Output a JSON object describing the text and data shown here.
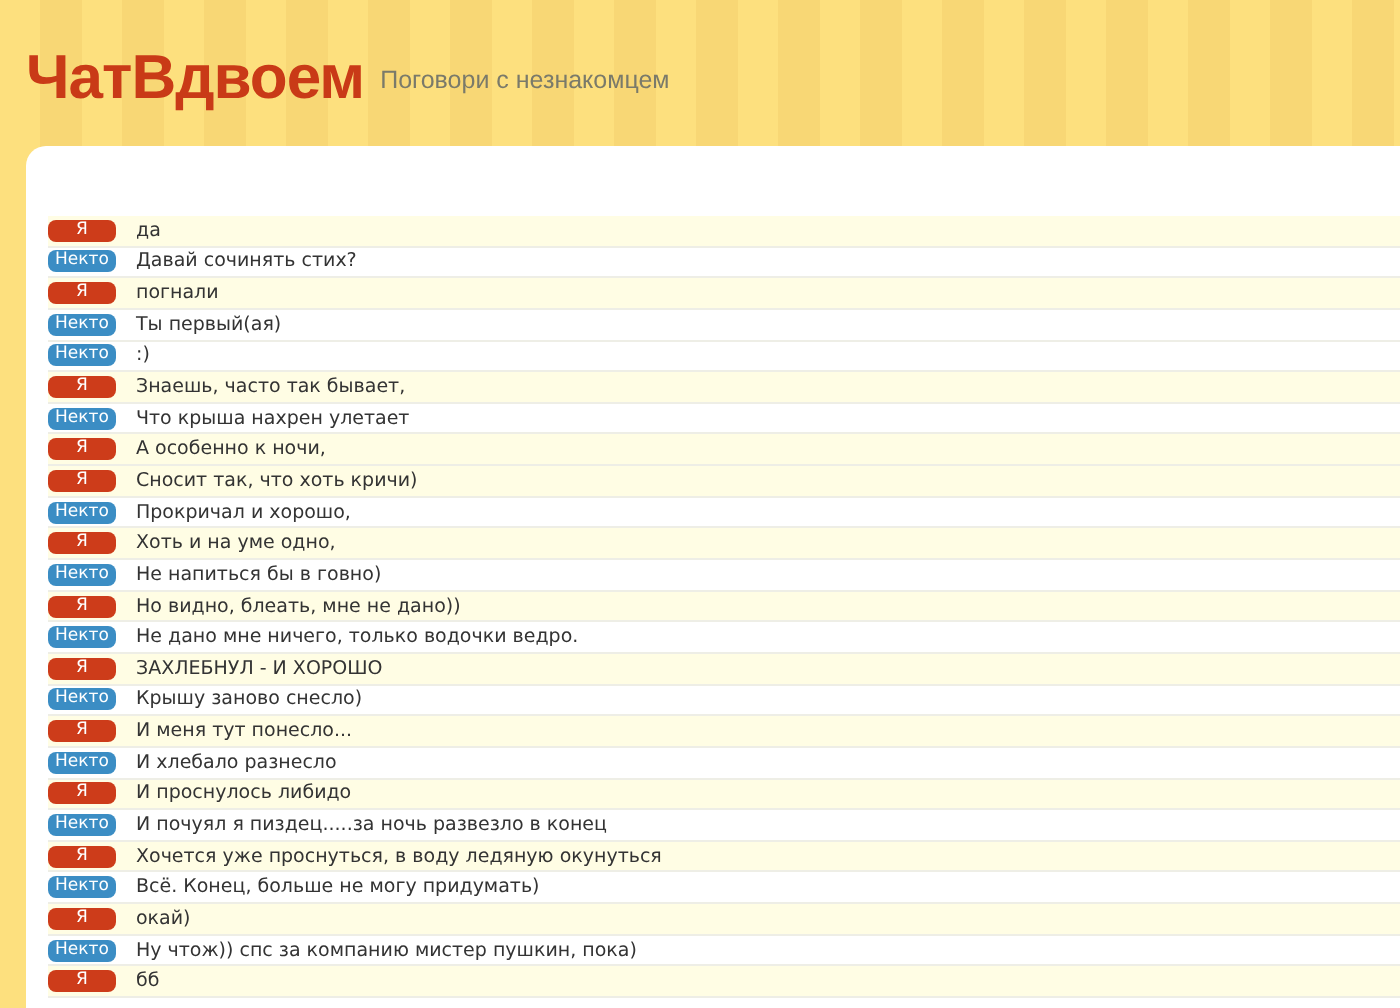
{
  "header": {
    "logo": "ЧатВдвоем",
    "tagline": "Поговори с незнакомцем"
  },
  "messages": [
    {
      "kind": "me",
      "sender": "Я",
      "text": "да"
    },
    {
      "kind": "stranger",
      "sender": "Некто",
      "text": "Давай сочинять стих?"
    },
    {
      "kind": "me",
      "sender": "Я",
      "text": "погнали"
    },
    {
      "kind": "stranger",
      "sender": "Некто",
      "text": "Ты первый(ая)"
    },
    {
      "kind": "stranger",
      "sender": "Некто",
      "text": ":)"
    },
    {
      "kind": "me",
      "sender": "Я",
      "text": "Знаешь, часто так бывает,"
    },
    {
      "kind": "stranger",
      "sender": "Некто",
      "text": "Что крыша нахрен улетает"
    },
    {
      "kind": "me",
      "sender": "Я",
      "text": "А особенно к ночи,"
    },
    {
      "kind": "me",
      "sender": "Я",
      "text": "Сносит так, что хоть кричи)"
    },
    {
      "kind": "stranger",
      "sender": "Некто",
      "text": "Прокричал и хорошо,"
    },
    {
      "kind": "me",
      "sender": "Я",
      "text": "Хоть и на уме одно,"
    },
    {
      "kind": "stranger",
      "sender": "Некто",
      "text": "Не напиться бы в говно)"
    },
    {
      "kind": "me",
      "sender": "Я",
      "text": "Но видно, блеать, мне не дано))"
    },
    {
      "kind": "stranger",
      "sender": "Некто",
      "text": "Не дано мне ничего, только водочки ведро."
    },
    {
      "kind": "me",
      "sender": "Я",
      "text": "ЗАХЛЕБНУЛ - И ХОРОШО"
    },
    {
      "kind": "stranger",
      "sender": "Некто",
      "text": "Крышу заново снесло)"
    },
    {
      "kind": "me",
      "sender": "Я",
      "text": "И меня тут понесло..."
    },
    {
      "kind": "stranger",
      "sender": "Некто",
      "text": "И хлебало разнесло"
    },
    {
      "kind": "me",
      "sender": "Я",
      "text": "И проснулось либидо"
    },
    {
      "kind": "stranger",
      "sender": "Некто",
      "text": "И почуял я пиздец.....за ночь развезло в конец"
    },
    {
      "kind": "me",
      "sender": "Я",
      "text": "Хочется уже проснуться, в воду ледяную окунуться"
    },
    {
      "kind": "stranger",
      "sender": "Некто",
      "text": "Всё. Конец, больше не могу придумать)"
    },
    {
      "kind": "me",
      "sender": "Я",
      "text": "окай)"
    },
    {
      "kind": "stranger",
      "sender": "Некто",
      "text": "Ну чтож)) спс за компанию мистер пушкин, пока)"
    },
    {
      "kind": "me",
      "sender": "Я",
      "text": "бб"
    }
  ]
}
